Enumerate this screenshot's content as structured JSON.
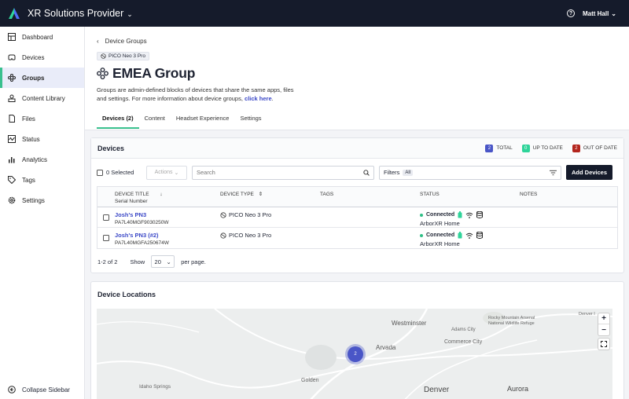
{
  "topbar": {
    "org_name": "XR Solutions Provider",
    "help_label": "?",
    "user_name": "Matt Hall"
  },
  "sidebar": {
    "items": [
      {
        "label": "Dashboard"
      },
      {
        "label": "Devices"
      },
      {
        "label": "Groups"
      },
      {
        "label": "Content Library"
      },
      {
        "label": "Files"
      },
      {
        "label": "Status"
      },
      {
        "label": "Analytics"
      },
      {
        "label": "Tags"
      },
      {
        "label": "Settings"
      }
    ],
    "collapse_label": "Collapse Sidebar"
  },
  "breadcrumb": {
    "label": "Device Groups"
  },
  "group": {
    "model_tag": "PICO Neo 3 Pro",
    "title": "EMEA Group",
    "description": "Groups are admin-defined blocks of devices that share the same apps, files and settings. For more information about device groups,",
    "link_text": "click here",
    "link_suffix": "."
  },
  "tabs": [
    {
      "label": "Devices (2)"
    },
    {
      "label": "Content"
    },
    {
      "label": "Headset Experience"
    },
    {
      "label": "Settings"
    }
  ],
  "devices_card": {
    "title": "Devices",
    "summary": {
      "total": {
        "count": "2",
        "label": "TOTAL",
        "color": "#4a56c7"
      },
      "up_to_date": {
        "count": "0",
        "label": "UP TO DATE",
        "color": "#2fd49a"
      },
      "out_of_date": {
        "count": "2",
        "label": "OUT OF DATE",
        "color": "#b3261e"
      }
    },
    "selected_label": "0 Selected",
    "actions_label": "Actions",
    "search_placeholder": "Search",
    "filters_label": "Filters",
    "filters_chip": "All",
    "add_button": "Add Devices",
    "columns": {
      "device_title": "DEVICE TITLE",
      "serial_number": "Serial Number",
      "device_type": "DEVICE TYPE",
      "tags": "TAGS",
      "status": "STATUS",
      "notes": "NOTES"
    },
    "rows": [
      {
        "name": "Josh's PN3",
        "serial": "PA7L40MGF9030250W",
        "type": "PICO Neo 3 Pro",
        "status": "Connected",
        "home": "ArborXR Home"
      },
      {
        "name": "Josh's PN3 (#2)",
        "serial": "PA7L40MGFA250674W",
        "type": "PICO Neo 3 Pro",
        "status": "Connected",
        "home": "ArborXR Home"
      }
    ],
    "pager": {
      "range": "1-2 of 2",
      "show_label": "Show",
      "per_page": "20",
      "per_page_label": "per page."
    }
  },
  "locations_card": {
    "title": "Device Locations",
    "cluster_count": "2",
    "places": [
      "Westminster",
      "Arvada",
      "Commerce City",
      "Adams City",
      "Golden",
      "Denver",
      "Aurora",
      "Idaho Springs",
      "Rocky Mountain Arsenal National Wildlife Refuge",
      "Denver I"
    ]
  }
}
